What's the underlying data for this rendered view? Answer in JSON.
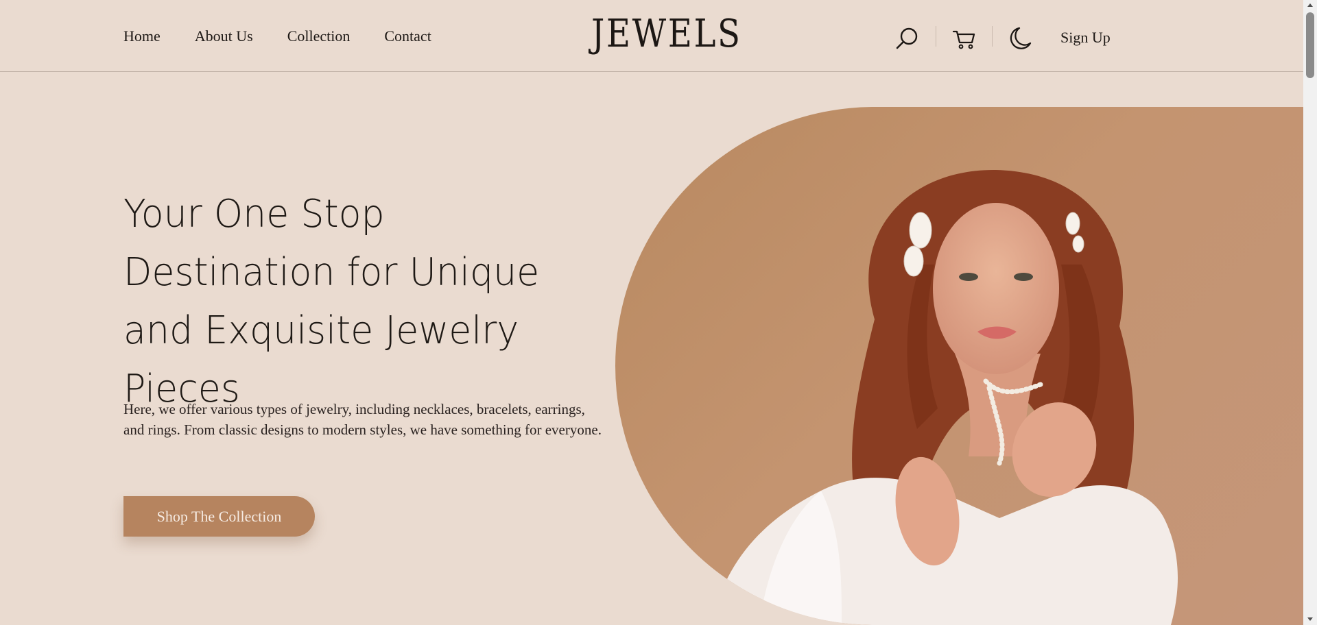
{
  "nav": {
    "items": [
      {
        "label": "Home"
      },
      {
        "label": "About Us"
      },
      {
        "label": "Collection"
      },
      {
        "label": "Contact"
      }
    ]
  },
  "brand": {
    "logo_text": "JEWELS"
  },
  "actions": {
    "icons": [
      "search-icon",
      "cart-icon",
      "moon-icon"
    ],
    "signup_label": "Sign Up"
  },
  "hero": {
    "title": "Your One Stop Destination for Unique and Exquisite Jewelry Pieces",
    "description": "Here, we offer various types of jewelry, including necklaces, bracelets, earrings, and rings. From classic designs to modern styles, we have something for everyone.",
    "cta_label": "Shop The Collection"
  },
  "colors": {
    "background": "#eadbd0",
    "accent": "#b6845f",
    "text": "#1c1714",
    "divider": "#bfb0a5"
  }
}
